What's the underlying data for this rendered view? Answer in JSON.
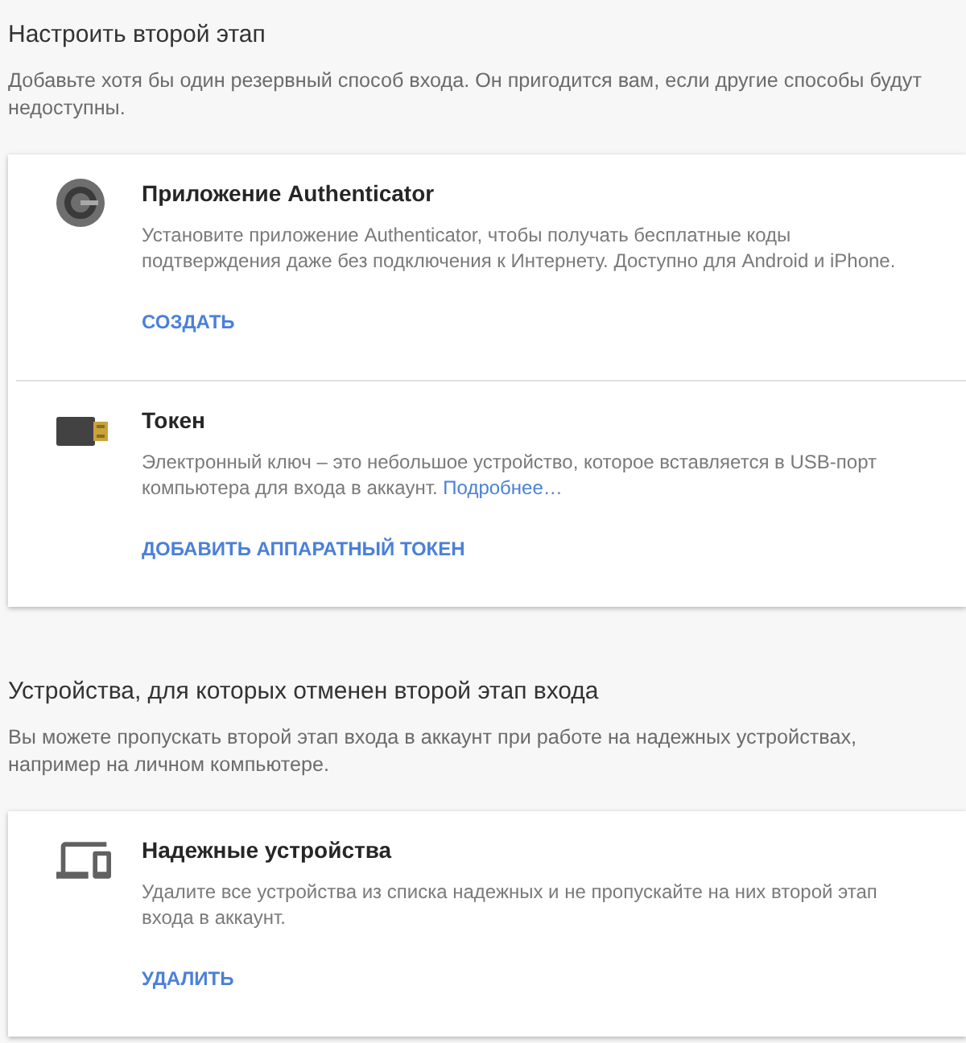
{
  "sections": [
    {
      "title": "Настроить второй этап",
      "description": "Добавьте хотя бы один резервный способ входа. Он пригодится вам, если другие способы будут недоступны.",
      "items": [
        {
          "kind": "authenticator",
          "title": "Приложение Authenticator",
          "description": "Установите приложение Authenticator, чтобы получать бесплатные коды подтверждения даже без подключения к Интернету. Доступно для Android и iPhone.",
          "action": "СОЗДАТЬ"
        },
        {
          "kind": "token",
          "title": "Токен",
          "description": "Электронный ключ – это небольшое устройство, которое вставляется в USB-порт компьютера для входа в аккаунт.",
          "link": "Подробнее…",
          "action": "ДОБАВИТЬ АППАРАТНЫЙ ТОКЕН"
        }
      ]
    },
    {
      "title": "Устройства, для которых отменен второй этап входа",
      "description": "Вы можете пропускать второй этап входа в аккаунт при работе на надежных устройствах, например на личном компьютере.",
      "items": [
        {
          "kind": "devices",
          "title": "Надежные устройства",
          "description": "Удалите все устройства из списка надежных и не пропускайте на них второй этап входа в аккаунт.",
          "action": "УДАЛИТЬ"
        }
      ]
    }
  ]
}
